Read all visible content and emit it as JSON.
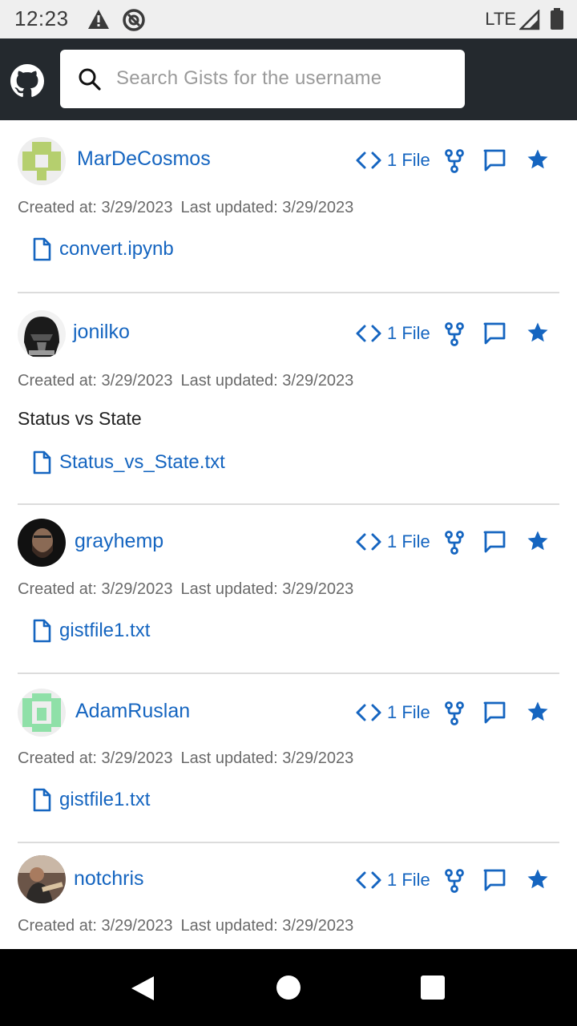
{
  "status_bar": {
    "time": "12:23",
    "network": "LTE"
  },
  "search": {
    "placeholder": "Search Gists for the username"
  },
  "colors": {
    "link": "#1565c0",
    "appbar": "#24292e"
  },
  "gists": [
    {
      "username": "MarDeCosmos",
      "files_label": "1 File",
      "created": "Created at: 3/29/2023",
      "updated": "Last updated: 3/29/2023",
      "description": "",
      "file": "convert.ipynb"
    },
    {
      "username": "jonilko",
      "files_label": "1 File",
      "created": "Created at: 3/29/2023",
      "updated": "Last updated: 3/29/2023",
      "description": "Status vs State",
      "file": "Status_vs_State.txt"
    },
    {
      "username": "grayhemp",
      "files_label": "1 File",
      "created": "Created at: 3/29/2023",
      "updated": "Last updated: 3/29/2023",
      "description": "",
      "file": "gistfile1.txt"
    },
    {
      "username": "AdamRuslan",
      "files_label": "1 File",
      "created": "Created at: 3/29/2023",
      "updated": "Last updated: 3/29/2023",
      "description": "",
      "file": "gistfile1.txt"
    },
    {
      "username": "notchris",
      "files_label": "1 File",
      "created": "Created at: 3/29/2023",
      "updated": "Last updated: 3/29/2023",
      "description": "",
      "file": ""
    }
  ]
}
